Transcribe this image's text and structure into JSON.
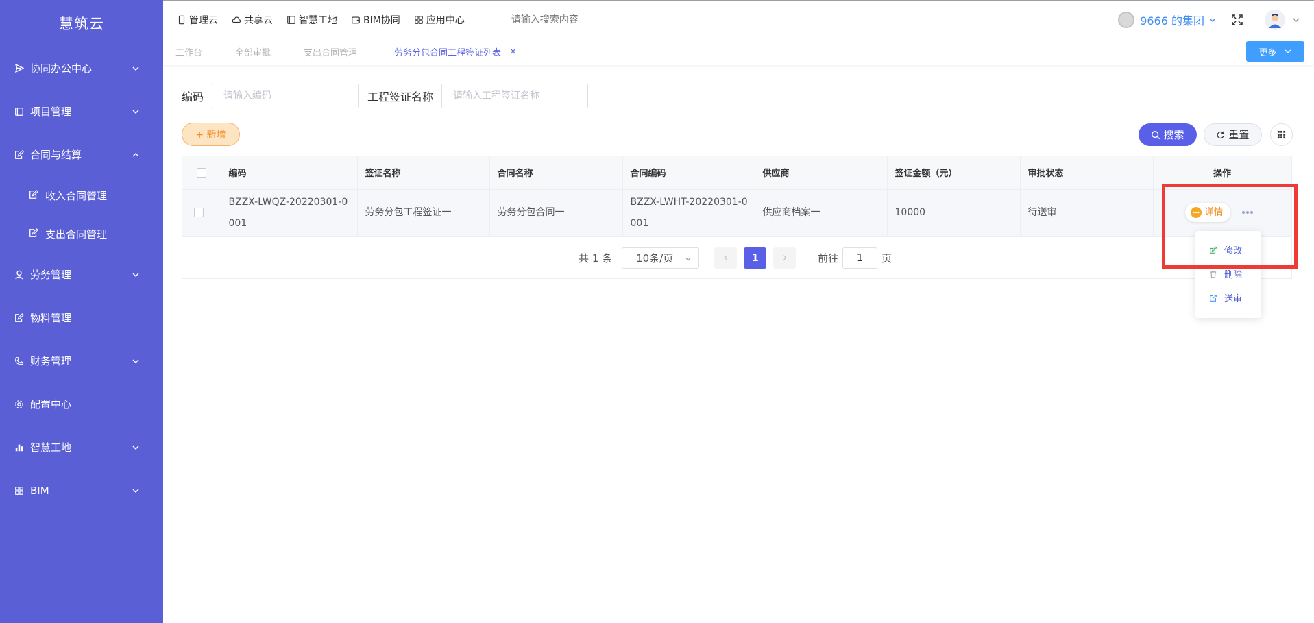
{
  "app": {
    "logo": "慧筑云"
  },
  "sidebar": {
    "items": [
      {
        "label": "协同办公中心",
        "icon": "send-icon",
        "chevron": "down"
      },
      {
        "label": "项目管理",
        "icon": "book-icon",
        "chevron": "down"
      },
      {
        "label": "合同与结算",
        "icon": "edit-doc-icon",
        "chevron": "up"
      },
      {
        "label": "劳务管理",
        "icon": "worker-icon",
        "chevron": "down"
      },
      {
        "label": "物料管理",
        "icon": "edit-doc-icon",
        "chevron": "none"
      },
      {
        "label": "财务管理",
        "icon": "phone-icon",
        "chevron": "down"
      },
      {
        "label": "配置中心",
        "icon": "gear-icon",
        "chevron": "none"
      },
      {
        "label": "智慧工地",
        "icon": "bar-chart-icon",
        "chevron": "down"
      },
      {
        "label": "BIM",
        "icon": "grid-icon",
        "chevron": "down"
      }
    ],
    "sub_items": [
      {
        "label": "收入合同管理",
        "icon": "edit-doc-icon"
      },
      {
        "label": "支出合同管理",
        "icon": "edit-doc-icon"
      }
    ]
  },
  "topnav": {
    "items": [
      {
        "label": "管理云",
        "icon": "phone-device-icon"
      },
      {
        "label": "共享云",
        "icon": "cloud-icon"
      },
      {
        "label": "智慧工地",
        "icon": "book-icon"
      },
      {
        "label": "BIM协同",
        "icon": "wallet-icon"
      },
      {
        "label": "应用中心",
        "icon": "apps-icon"
      }
    ],
    "search_placeholder": "请输入搜索内容",
    "org_name": "9666 的集团"
  },
  "tabs": {
    "items": [
      {
        "label": "工作台",
        "active": false
      },
      {
        "label": "全部审批",
        "active": false
      },
      {
        "label": "支出合同管理",
        "active": false
      },
      {
        "label": "劳务分包合同工程签证列表",
        "active": true
      }
    ],
    "close_glyph": "×",
    "more_label": "更多"
  },
  "filters": {
    "code_label": "编码",
    "code_placeholder": "请输入编码",
    "name_label": "工程签证名称",
    "name_placeholder": "请输入工程签证名称"
  },
  "actions": {
    "add_label": "+ 新增",
    "search_label": "搜索",
    "reset_label": "重置"
  },
  "table": {
    "columns": [
      "编码",
      "签证名称",
      "合同名称",
      "合同编码",
      "供应商",
      "签证金额（元）",
      "审批状态",
      "操作"
    ],
    "rows": [
      {
        "code": "BZZX-LWQZ-20220301-0001",
        "visa_name": "劳务分包工程签证一",
        "contract_name": "劳务分包合同一",
        "contract_code": "BZZX-LWHT-20220301-0001",
        "supplier": "供应商档案一",
        "amount": "10000",
        "status": "待送审",
        "detail_label": "详情"
      }
    ]
  },
  "pagination": {
    "total_text": "共 1 条",
    "page_size": "10条/页",
    "current_page": "1",
    "goto_label": "前往",
    "goto_value": "1",
    "page_suffix": "页"
  },
  "dropdown": {
    "items": [
      {
        "label": "修改",
        "icon": "edit-icon",
        "color": "#45b36b"
      },
      {
        "label": "删除",
        "icon": "trash-icon",
        "color": "#9aa0a6"
      },
      {
        "label": "送审",
        "icon": "submit-icon",
        "color": "#409eff"
      }
    ]
  },
  "colors": {
    "sidebar_bg": "#5a5fd6",
    "accent": "#5a5fe8",
    "add_orange": "#f0912c",
    "highlight_red": "#ee3b35",
    "more_button": "#409eff"
  }
}
